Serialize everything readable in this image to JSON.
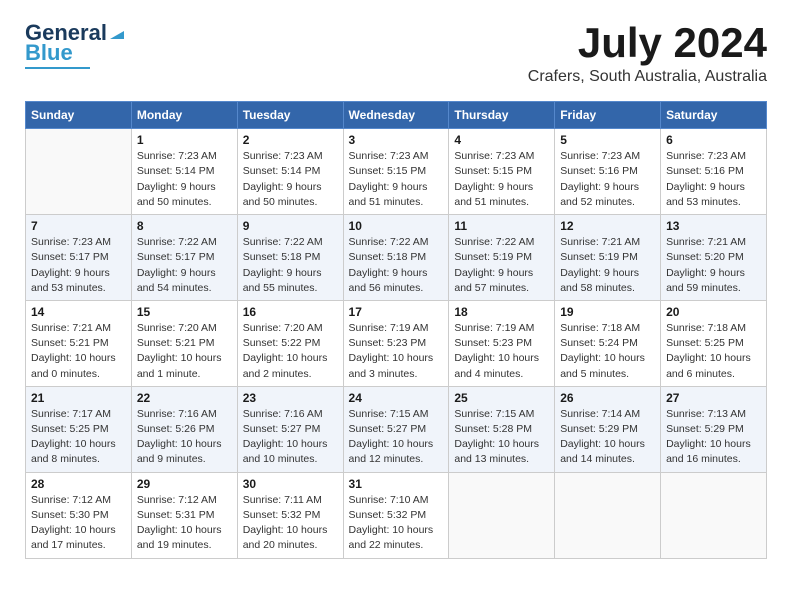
{
  "header": {
    "logo_general": "General",
    "logo_blue": "Blue",
    "title": "July 2024",
    "subtitle": "Crafers, South Australia, Australia"
  },
  "calendar": {
    "days_of_week": [
      "Sunday",
      "Monday",
      "Tuesday",
      "Wednesday",
      "Thursday",
      "Friday",
      "Saturday"
    ],
    "weeks": [
      [
        {
          "day": "",
          "sunrise": "",
          "sunset": "",
          "daylight": "",
          "empty": true
        },
        {
          "day": "1",
          "sunrise": "Sunrise: 7:23 AM",
          "sunset": "Sunset: 5:14 PM",
          "daylight": "Daylight: 9 hours and 50 minutes.",
          "empty": false
        },
        {
          "day": "2",
          "sunrise": "Sunrise: 7:23 AM",
          "sunset": "Sunset: 5:14 PM",
          "daylight": "Daylight: 9 hours and 50 minutes.",
          "empty": false
        },
        {
          "day": "3",
          "sunrise": "Sunrise: 7:23 AM",
          "sunset": "Sunset: 5:15 PM",
          "daylight": "Daylight: 9 hours and 51 minutes.",
          "empty": false
        },
        {
          "day": "4",
          "sunrise": "Sunrise: 7:23 AM",
          "sunset": "Sunset: 5:15 PM",
          "daylight": "Daylight: 9 hours and 51 minutes.",
          "empty": false
        },
        {
          "day": "5",
          "sunrise": "Sunrise: 7:23 AM",
          "sunset": "Sunset: 5:16 PM",
          "daylight": "Daylight: 9 hours and 52 minutes.",
          "empty": false
        },
        {
          "day": "6",
          "sunrise": "Sunrise: 7:23 AM",
          "sunset": "Sunset: 5:16 PM",
          "daylight": "Daylight: 9 hours and 53 minutes.",
          "empty": false
        }
      ],
      [
        {
          "day": "7",
          "sunrise": "Sunrise: 7:23 AM",
          "sunset": "Sunset: 5:17 PM",
          "daylight": "Daylight: 9 hours and 53 minutes.",
          "empty": false
        },
        {
          "day": "8",
          "sunrise": "Sunrise: 7:22 AM",
          "sunset": "Sunset: 5:17 PM",
          "daylight": "Daylight: 9 hours and 54 minutes.",
          "empty": false
        },
        {
          "day": "9",
          "sunrise": "Sunrise: 7:22 AM",
          "sunset": "Sunset: 5:18 PM",
          "daylight": "Daylight: 9 hours and 55 minutes.",
          "empty": false
        },
        {
          "day": "10",
          "sunrise": "Sunrise: 7:22 AM",
          "sunset": "Sunset: 5:18 PM",
          "daylight": "Daylight: 9 hours and 56 minutes.",
          "empty": false
        },
        {
          "day": "11",
          "sunrise": "Sunrise: 7:22 AM",
          "sunset": "Sunset: 5:19 PM",
          "daylight": "Daylight: 9 hours and 57 minutes.",
          "empty": false
        },
        {
          "day": "12",
          "sunrise": "Sunrise: 7:21 AM",
          "sunset": "Sunset: 5:19 PM",
          "daylight": "Daylight: 9 hours and 58 minutes.",
          "empty": false
        },
        {
          "day": "13",
          "sunrise": "Sunrise: 7:21 AM",
          "sunset": "Sunset: 5:20 PM",
          "daylight": "Daylight: 9 hours and 59 minutes.",
          "empty": false
        }
      ],
      [
        {
          "day": "14",
          "sunrise": "Sunrise: 7:21 AM",
          "sunset": "Sunset: 5:21 PM",
          "daylight": "Daylight: 10 hours and 0 minutes.",
          "empty": false
        },
        {
          "day": "15",
          "sunrise": "Sunrise: 7:20 AM",
          "sunset": "Sunset: 5:21 PM",
          "daylight": "Daylight: 10 hours and 1 minute.",
          "empty": false
        },
        {
          "day": "16",
          "sunrise": "Sunrise: 7:20 AM",
          "sunset": "Sunset: 5:22 PM",
          "daylight": "Daylight: 10 hours and 2 minutes.",
          "empty": false
        },
        {
          "day": "17",
          "sunrise": "Sunrise: 7:19 AM",
          "sunset": "Sunset: 5:23 PM",
          "daylight": "Daylight: 10 hours and 3 minutes.",
          "empty": false
        },
        {
          "day": "18",
          "sunrise": "Sunrise: 7:19 AM",
          "sunset": "Sunset: 5:23 PM",
          "daylight": "Daylight: 10 hours and 4 minutes.",
          "empty": false
        },
        {
          "day": "19",
          "sunrise": "Sunrise: 7:18 AM",
          "sunset": "Sunset: 5:24 PM",
          "daylight": "Daylight: 10 hours and 5 minutes.",
          "empty": false
        },
        {
          "day": "20",
          "sunrise": "Sunrise: 7:18 AM",
          "sunset": "Sunset: 5:25 PM",
          "daylight": "Daylight: 10 hours and 6 minutes.",
          "empty": false
        }
      ],
      [
        {
          "day": "21",
          "sunrise": "Sunrise: 7:17 AM",
          "sunset": "Sunset: 5:25 PM",
          "daylight": "Daylight: 10 hours and 8 minutes.",
          "empty": false
        },
        {
          "day": "22",
          "sunrise": "Sunrise: 7:16 AM",
          "sunset": "Sunset: 5:26 PM",
          "daylight": "Daylight: 10 hours and 9 minutes.",
          "empty": false
        },
        {
          "day": "23",
          "sunrise": "Sunrise: 7:16 AM",
          "sunset": "Sunset: 5:27 PM",
          "daylight": "Daylight: 10 hours and 10 minutes.",
          "empty": false
        },
        {
          "day": "24",
          "sunrise": "Sunrise: 7:15 AM",
          "sunset": "Sunset: 5:27 PM",
          "daylight": "Daylight: 10 hours and 12 minutes.",
          "empty": false
        },
        {
          "day": "25",
          "sunrise": "Sunrise: 7:15 AM",
          "sunset": "Sunset: 5:28 PM",
          "daylight": "Daylight: 10 hours and 13 minutes.",
          "empty": false
        },
        {
          "day": "26",
          "sunrise": "Sunrise: 7:14 AM",
          "sunset": "Sunset: 5:29 PM",
          "daylight": "Daylight: 10 hours and 14 minutes.",
          "empty": false
        },
        {
          "day": "27",
          "sunrise": "Sunrise: 7:13 AM",
          "sunset": "Sunset: 5:29 PM",
          "daylight": "Daylight: 10 hours and 16 minutes.",
          "empty": false
        }
      ],
      [
        {
          "day": "28",
          "sunrise": "Sunrise: 7:12 AM",
          "sunset": "Sunset: 5:30 PM",
          "daylight": "Daylight: 10 hours and 17 minutes.",
          "empty": false
        },
        {
          "day": "29",
          "sunrise": "Sunrise: 7:12 AM",
          "sunset": "Sunset: 5:31 PM",
          "daylight": "Daylight: 10 hours and 19 minutes.",
          "empty": false
        },
        {
          "day": "30",
          "sunrise": "Sunrise: 7:11 AM",
          "sunset": "Sunset: 5:32 PM",
          "daylight": "Daylight: 10 hours and 20 minutes.",
          "empty": false
        },
        {
          "day": "31",
          "sunrise": "Sunrise: 7:10 AM",
          "sunset": "Sunset: 5:32 PM",
          "daylight": "Daylight: 10 hours and 22 minutes.",
          "empty": false
        },
        {
          "day": "",
          "sunrise": "",
          "sunset": "",
          "daylight": "",
          "empty": true
        },
        {
          "day": "",
          "sunrise": "",
          "sunset": "",
          "daylight": "",
          "empty": true
        },
        {
          "day": "",
          "sunrise": "",
          "sunset": "",
          "daylight": "",
          "empty": true
        }
      ]
    ]
  }
}
